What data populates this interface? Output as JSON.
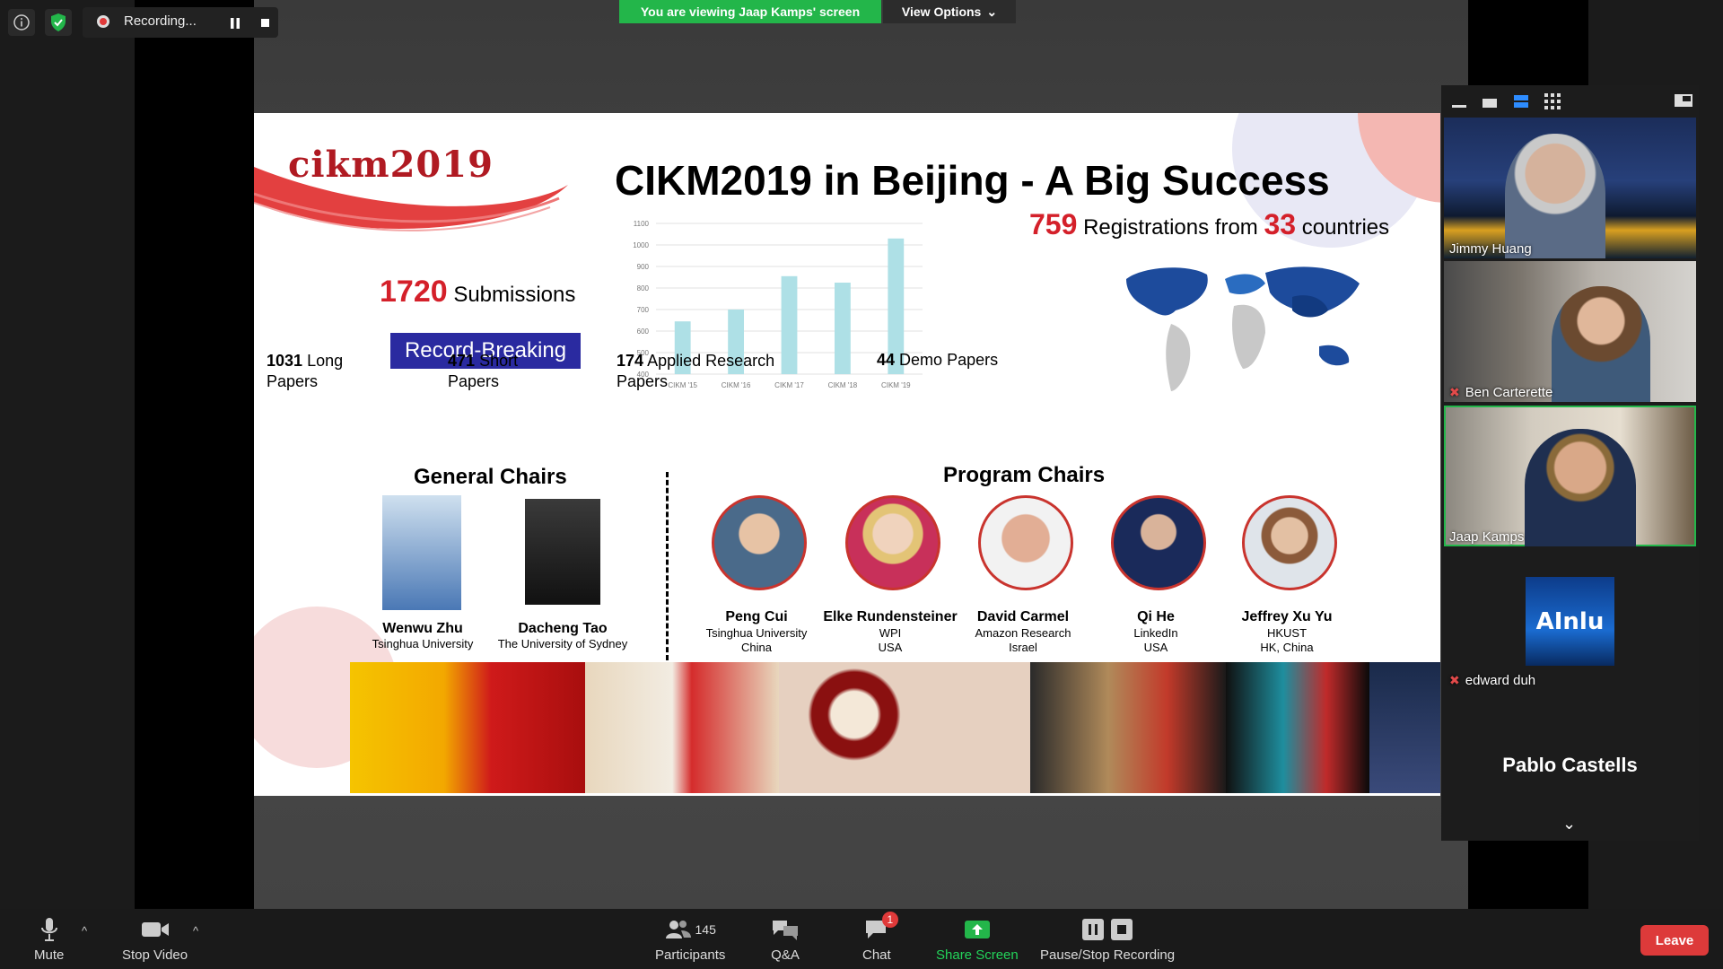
{
  "top_bar": {
    "info_icon": "info-icon",
    "security_icon": "shield-check-icon",
    "recording_label": "Recording...",
    "viewing_banner": "You are viewing Jaap Kamps' screen",
    "view_options_label": "View Options"
  },
  "slide": {
    "logo_text": "cikm2019",
    "title": "CIKM2019 in Beijing - A Big Success",
    "submissions_count": "1720",
    "submissions_label": "Submissions",
    "record_badge": "Record-Breaking",
    "registrations_count": "759",
    "registrations_mid": "Registrations from",
    "countries_count": "33",
    "countries_label": "countries",
    "paper_stats": [
      {
        "count": "1031",
        "label": "Long",
        "label2": "Papers"
      },
      {
        "count": "471",
        "label": "Short",
        "label2": "Papers"
      },
      {
        "count": "174",
        "label": "Applied Research",
        "label2": "Papers"
      },
      {
        "count": "44",
        "label": "Demo Papers",
        "label2": ""
      }
    ],
    "general_chairs_title": "General Chairs",
    "general_chairs": [
      {
        "name": "Wenwu Zhu",
        "affiliation": "Tsinghua University"
      },
      {
        "name": "Dacheng Tao",
        "affiliation": "The University of Sydney"
      }
    ],
    "program_chairs_title": "Program Chairs",
    "program_chairs": [
      {
        "name": "Peng Cui",
        "org": "Tsinghua University",
        "country": "China"
      },
      {
        "name": "Elke Rundensteiner",
        "org": "WPI",
        "country": "USA"
      },
      {
        "name": "David Carmel",
        "org": "Amazon Research",
        "country": "Israel"
      },
      {
        "name": "Qi He",
        "org": "LinkedIn",
        "country": "USA"
      },
      {
        "name": "Jeffrey Xu Yu",
        "org": "HKUST",
        "country": "HK, China"
      }
    ]
  },
  "chart_data": {
    "type": "bar",
    "categories": [
      "CIKM '15",
      "CIKM '16",
      "CIKM '17",
      "CIKM '18",
      "CIKM '19"
    ],
    "values": [
      645,
      700,
      855,
      825,
      1030
    ],
    "ylim": [
      400,
      1100
    ],
    "yticks": [
      "1100",
      "1000",
      "900",
      "800",
      "700",
      "600",
      "500",
      "400"
    ],
    "bar_color": "#aee0e6",
    "grid": true
  },
  "gallery": {
    "participants": [
      {
        "name": "Jimmy Huang",
        "muted": false
      },
      {
        "name": "Ben Carterette",
        "muted": true
      },
      {
        "name": "Jaap Kamps",
        "muted": false,
        "active_speaker": true
      },
      {
        "name": "edward duh",
        "muted": true,
        "avatar_text": "AInlu"
      },
      {
        "name": "Pablo Castells",
        "muted": false,
        "video_off": true
      }
    ]
  },
  "toolbar": {
    "mute_label": "Mute",
    "stop_video_label": "Stop Video",
    "participants_label": "Participants",
    "participants_count": "145",
    "qa_label": "Q&A",
    "chat_label": "Chat",
    "chat_badge": "1",
    "share_label": "Share Screen",
    "recording_label": "Pause/Stop Recording",
    "leave_label": "Leave"
  },
  "colors": {
    "accent_green": "#23b64a",
    "leave_red": "#dd3a3a",
    "slide_red": "#d4202a",
    "badge_blue": "#2a2aa0"
  }
}
